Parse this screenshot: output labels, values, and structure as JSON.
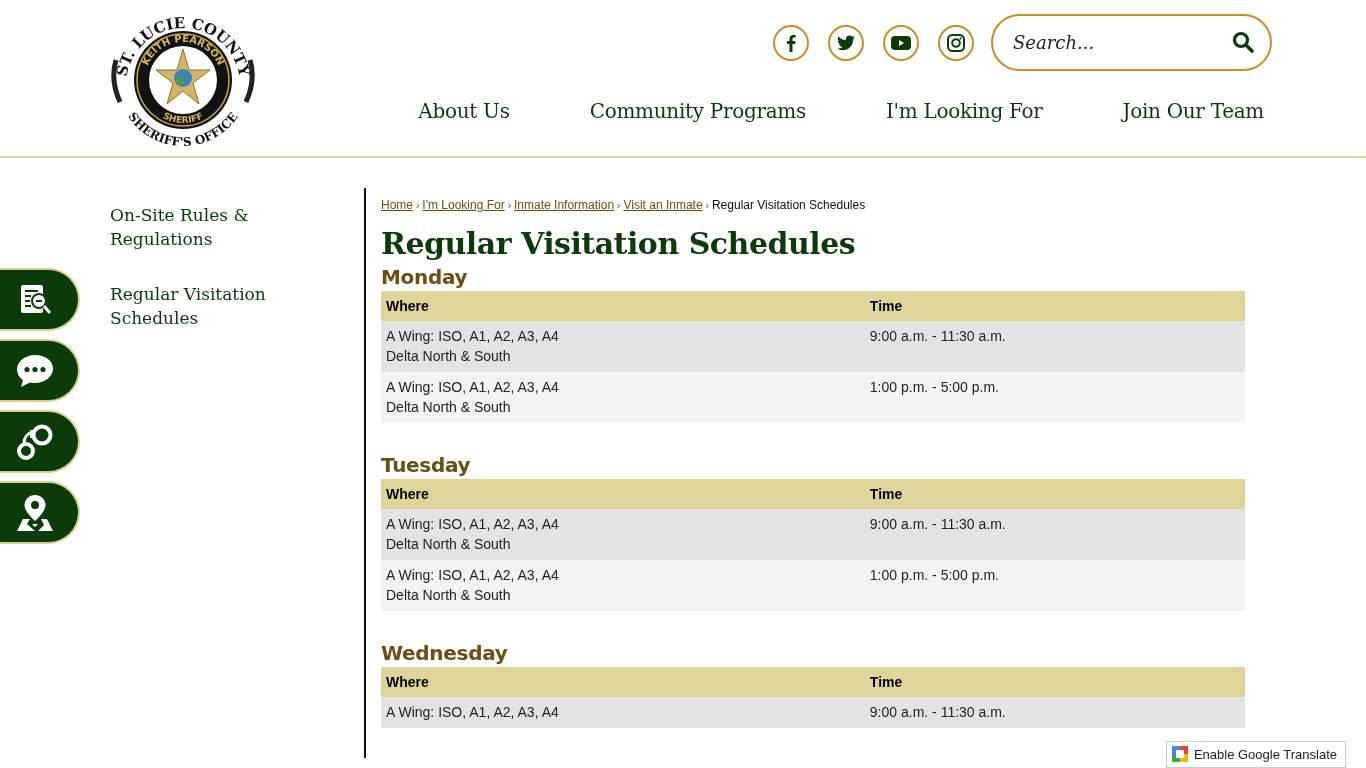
{
  "logo": {
    "top_text": "ST. LUCIE COUNTY",
    "ring_top": "KEITH PEARSON",
    "ring_bottom": "SHERIFF",
    "bottom_text": "SHERIFF'S OFFICE"
  },
  "social": [
    {
      "kind": "facebook"
    },
    {
      "kind": "twitter"
    },
    {
      "kind": "youtube"
    },
    {
      "kind": "instagram"
    }
  ],
  "search": {
    "placeholder": "Search..."
  },
  "nav": [
    "About Us",
    "Community Programs",
    "I'm Looking For",
    "Join Our Team"
  ],
  "side_tabs": [
    {
      "kind": "document"
    },
    {
      "kind": "chat"
    },
    {
      "kind": "handcuffs"
    },
    {
      "kind": "map"
    }
  ],
  "sidebar": {
    "items": [
      "On-Site Rules & Regulations",
      "Regular Visitation Schedules"
    ]
  },
  "breadcrumb": {
    "links": [
      "Home",
      "I'm Looking For",
      "Inmate Information",
      "Visit an Inmate"
    ],
    "separator": "›",
    "current": "Regular Visitation Schedules"
  },
  "title": "Regular Visitation Schedules",
  "schedules": [
    {
      "day": "Monday",
      "columns": [
        "Where",
        "Time"
      ],
      "rows": [
        {
          "where": [
            "A Wing: ISO, A1, A2, A3, A4",
            "Delta North & South"
          ],
          "time": "9:00 a.m. - 11:30 a.m."
        },
        {
          "where": [
            "A Wing: ISO, A1, A2, A3, A4",
            "Delta North & South"
          ],
          "time": "1:00 p.m. - 5:00 p.m."
        }
      ]
    },
    {
      "day": "Tuesday",
      "columns": [
        "Where",
        "Time"
      ],
      "rows": [
        {
          "where": [
            "A Wing: ISO, A1, A2, A3, A4",
            "Delta North & South"
          ],
          "time": "9:00 a.m. - 11:30 a.m."
        },
        {
          "where": [
            "A Wing: ISO, A1, A2, A3, A4",
            "Delta North & South"
          ],
          "time": "1:00 p.m. - 5:00 p.m."
        }
      ]
    },
    {
      "day": "Wednesday",
      "columns": [
        "Where",
        "Time"
      ],
      "rows": [
        {
          "where": [
            "A Wing: ISO, A1, A2, A3, A4"
          ],
          "time": "9:00 a.m. - 11:30 a.m."
        }
      ]
    }
  ],
  "translate": {
    "label": "Enable Google Translate"
  }
}
